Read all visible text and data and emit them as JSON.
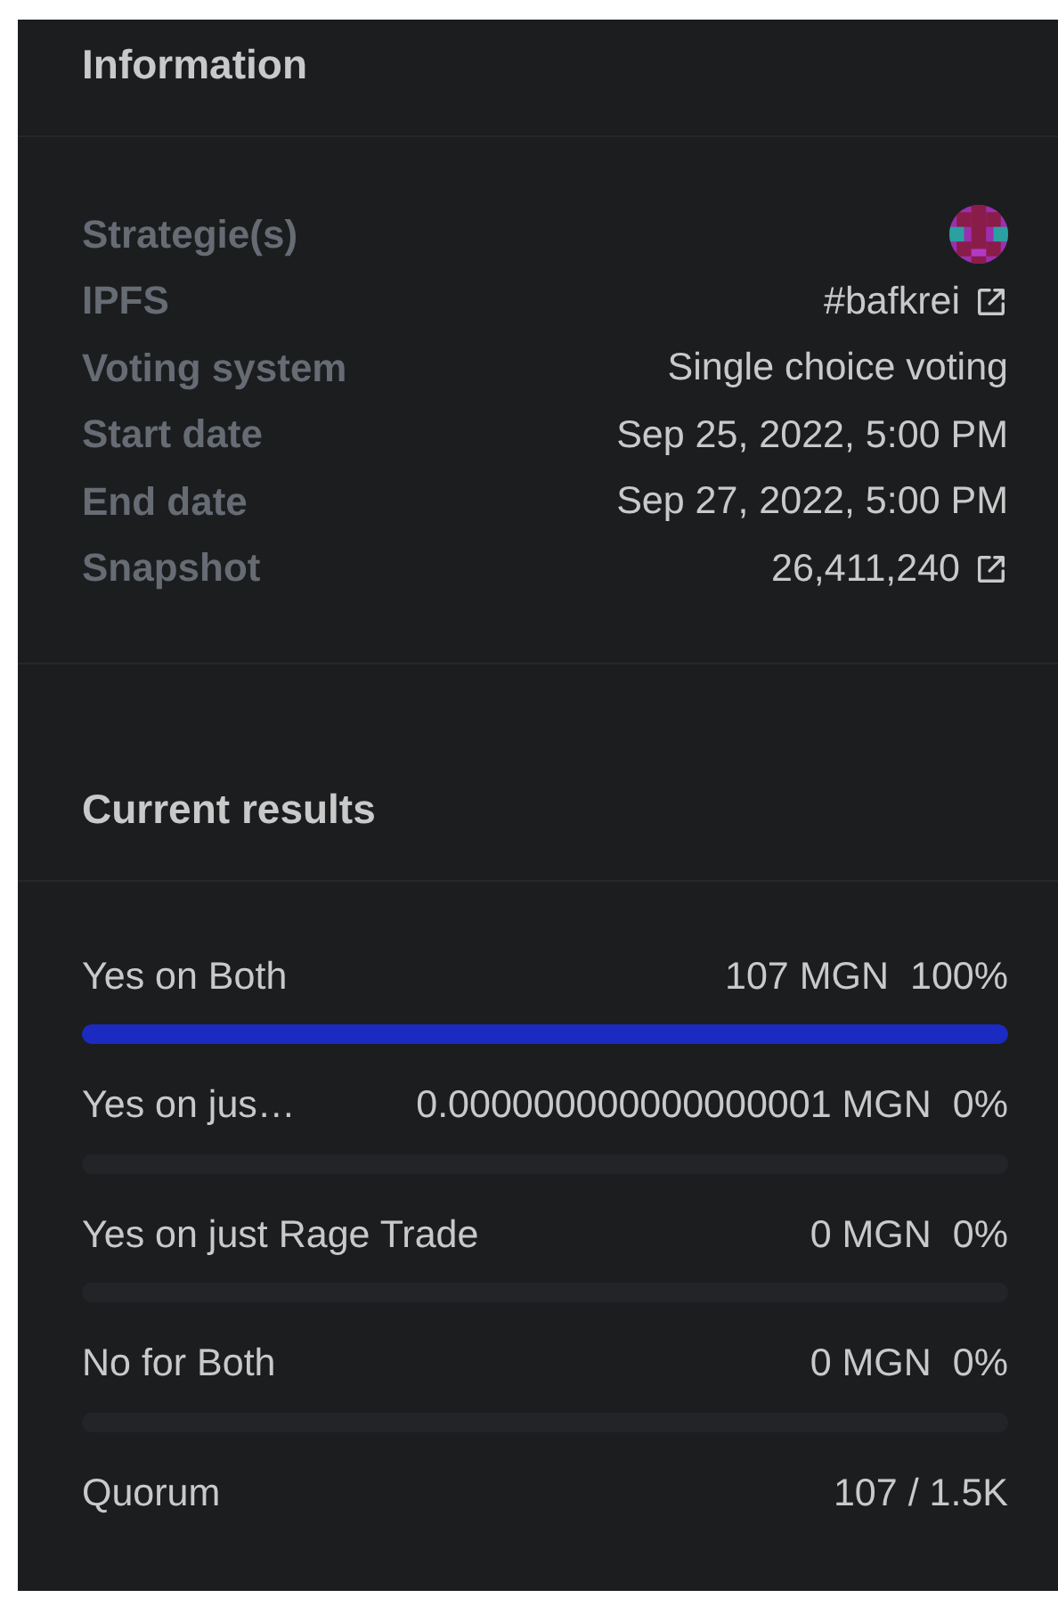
{
  "information": {
    "title": "Information",
    "rows": [
      {
        "label": "Strategie(s)",
        "kind": "avatar"
      },
      {
        "label": "IPFS",
        "kind": "link",
        "value": "#bafkrei"
      },
      {
        "label": "Voting system",
        "kind": "text",
        "value": "Single choice voting"
      },
      {
        "label": "Start date",
        "kind": "text",
        "value": "Sep 25, 2022, 5:00 PM"
      },
      {
        "label": "End date",
        "kind": "text",
        "value": "Sep 27, 2022, 5:00 PM"
      },
      {
        "label": "Snapshot",
        "kind": "link",
        "value": "26,411,240"
      }
    ]
  },
  "results": {
    "title": "Current results",
    "choices": [
      {
        "label": "Yes on Both",
        "amount": "107 MGN",
        "percent": "100%",
        "level": 1
      },
      {
        "label": "Yes on jus…",
        "amount": "0.000000000000000001 MGN",
        "percent": "0%",
        "level": 0
      },
      {
        "label": "Yes on just Rage Trade",
        "amount": "0 MGN",
        "percent": "0%",
        "level": 0
      },
      {
        "label": "No for Both",
        "amount": "0 MGN",
        "percent": "0%",
        "level": 0
      }
    ],
    "quorum": {
      "label": "Quorum",
      "value": "107 / 1.5K"
    }
  }
}
